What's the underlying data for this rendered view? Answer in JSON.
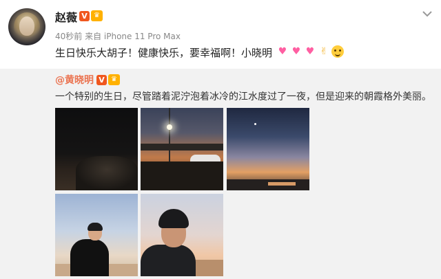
{
  "post": {
    "username": "赵薇",
    "meta": "40秒前 来自 iPhone 11 Pro Max",
    "text": "生日快乐大胡子！健康快乐，要幸福啊！小晓明"
  },
  "emojis": [
    "heart-icon",
    "heart-icon",
    "heart-icon",
    "hand-icon",
    "smile-icon"
  ],
  "repost": {
    "author": "@黄晓明",
    "text": "一个特别的生日，尽管踏着泥泞泡着冰冷的江水度过了一夜，但是迎来的朝霞格外美丽。"
  },
  "colors": {
    "repost_author": "#eb7350",
    "repost_bg": "#f2f2f2",
    "vip_badge": "#f0571e",
    "crown_badge": "#ffb100"
  }
}
